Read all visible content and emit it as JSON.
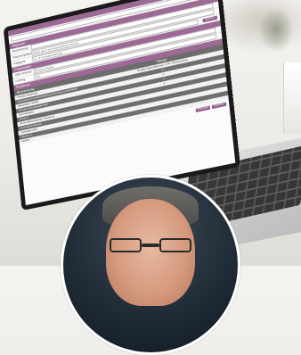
{
  "form": {
    "app_bar": "",
    "section1": {
      "title": "Allgemein",
      "rows": [
        {
          "label": "Bezeichnung",
          "value": ""
        },
        {
          "label": "Ansprechpartner",
          "value": "Zweck gleich wie Ansprechpartner Vertrieb"
        },
        {
          "label": "Kategorie",
          "value": "Nr. 12 Vertragsbestandteile"
        }
      ],
      "button": "Speichern"
    },
    "section2": {
      "title": "Projektdaten",
      "rows": [
        {
          "label": "Start Zeitraum",
          "value": "Bis Ende Oktober"
        },
        {
          "label": "Umfang",
          "value": "100"
        }
      ]
    },
    "table": {
      "header": "Positionen",
      "columns": [
        "Bezeichnung",
        "Menge"
      ],
      "rows": [
        {
          "name": "Projekt-Abschluss",
          "value": "Projekt Sales Betreuer 1 (Hr. 46 kostenlos)"
        },
        {
          "name": "Lizenzkosten Implementierung (Service-Level) MQM",
          "value": "2"
        },
        {
          "name": "Basisdaten SPMS",
          "value": "1"
        },
        {
          "name": "Dokumentenmanagement",
          "value": "1"
        },
        {
          "name": "Schnittstellen",
          "value": "1"
        },
        {
          "name": "Portal 4",
          "value": ""
        },
        {
          "name": "Personalverwaltung / Assistent",
          "value": ""
        },
        {
          "name": "Controlling Module",
          "value": ""
        },
        {
          "name": "Vertragsmodul",
          "value": ""
        },
        {
          "name": "Service 1",
          "value": ""
        },
        {
          "name": "Hotline",
          "value": ""
        }
      ],
      "footer_buttons": [
        "Abbrechen",
        "Speichern"
      ]
    }
  }
}
